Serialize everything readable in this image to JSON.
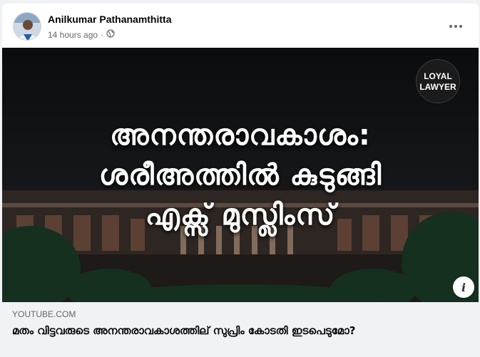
{
  "post": {
    "author": "Anilkumar Pathanamthitta",
    "timestamp": "14 hours ago",
    "separator": "·",
    "audience_icon": "globe-icon",
    "more_icon": "more-options-icon"
  },
  "thumbnail": {
    "headline_line1": "അനന്തരാവകാശം:",
    "headline_line2": "ശരീഅത്തിൽ കുടുങ്ങി",
    "headline_line3": "എക്സ് മുസ്ലിംസ്",
    "logo_line1": "LOYAL",
    "logo_line2": "LAWYER",
    "info_icon": "info-icon"
  },
  "link": {
    "domain": "YOUTUBE.COM",
    "title": "മതം വിട്ടവരുടെ അനന്തരാവകാശത്തില് സുപ്രിം കോടതി ഇടപെടുമോ?"
  },
  "colors": {
    "card_bg": "#ffffff",
    "page_bg": "#f0f2f5",
    "secondary_text": "#65676b",
    "primary_text": "#050505"
  }
}
